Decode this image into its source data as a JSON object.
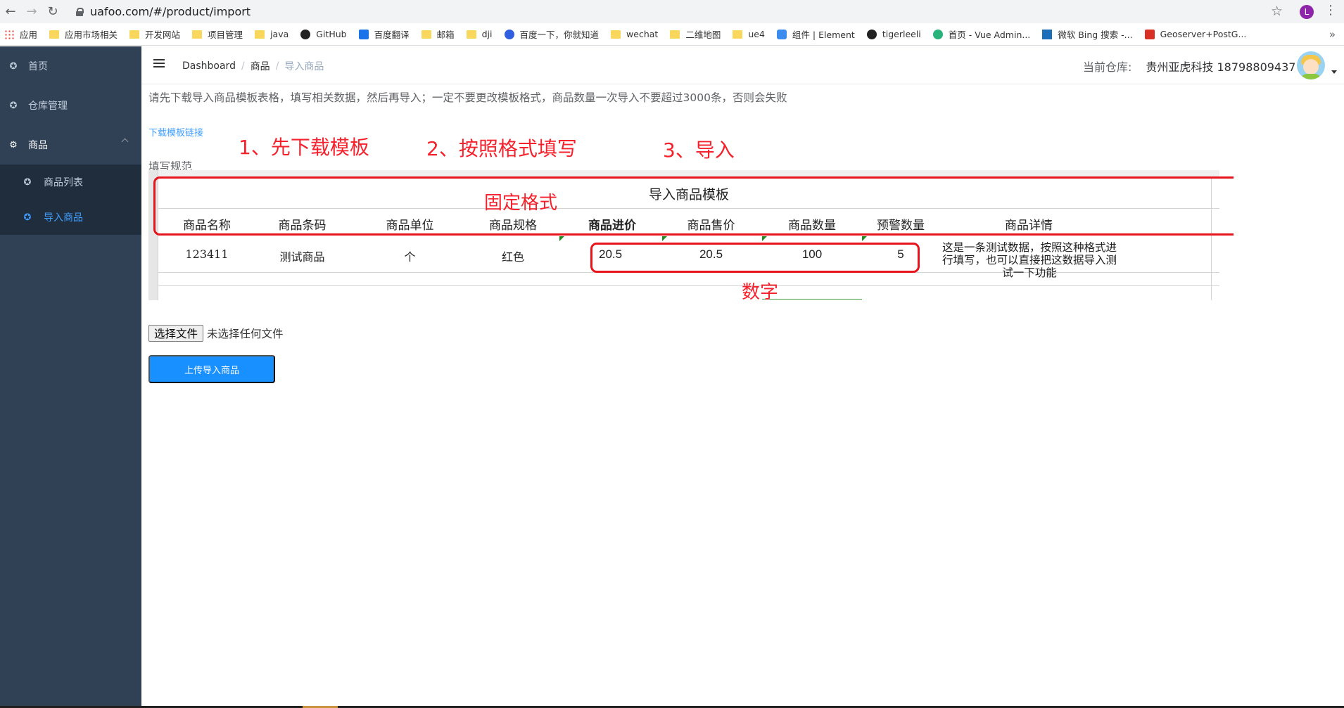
{
  "browser": {
    "url": "uafoo.com/#/product/import",
    "profile_initial": "L",
    "bookmarks": [
      "应用",
      "应用市场相关",
      "开发网站",
      "项目管理",
      "java",
      "GitHub",
      "百度翻译",
      "邮箱",
      "dji",
      "百度一下，你就知道",
      "wechat",
      "二维地图",
      "ue4",
      "组件 | Element",
      "tigerleeli",
      "首页 - Vue Admin...",
      "微软 Bing 搜索 -...",
      "Geoserver+PostG..."
    ],
    "bookmark_icons": [
      "apps-icon",
      "folder-icon",
      "folder-icon",
      "folder-icon",
      "folder-icon",
      "github-icon",
      "translate-icon",
      "folder-icon",
      "folder-icon",
      "baidu-icon",
      "folder-icon",
      "folder-icon",
      "folder-icon",
      "element-icon",
      "github-icon",
      "vue-icon",
      "bing-icon",
      "geoserver-icon"
    ],
    "more": "»"
  },
  "sidebar": {
    "home": "首页",
    "warehouse": "仓库管理",
    "product": "商品",
    "product_list": "商品列表",
    "import_product": "导入商品"
  },
  "navbar": {
    "breadcrumb": [
      "Dashboard",
      "商品",
      "导入商品"
    ],
    "warehouse_label": "当前仓库:",
    "warehouse_value": "贵州亚虎科技 18798809437"
  },
  "content": {
    "notice": "请先下载导入商品模板表格，填写相关数据，然后再导入；一定不要更改模板格式，商品数量一次导入不要超过3000条，否则会失败",
    "download_link": "下载模板链接",
    "rule_label": "填写规范",
    "file_button": "选择文件",
    "file_none": "未选择任何文件",
    "upload_button": "上传导入商品"
  },
  "annotations": {
    "step1": "1、先下载模板",
    "step2": "2、按照格式填写",
    "step3": "3、导入",
    "fixed": "固定格式",
    "number": "数字",
    "color": "#f5222d"
  },
  "template": {
    "title": "导入商品模板",
    "headers": [
      "商品名称",
      "商品条码",
      "商品单位",
      "商品规格",
      "商品进价",
      "商品售价",
      "商品数量",
      "预警数量",
      "商品详情"
    ],
    "row": [
      "123411",
      "测试商品",
      "个",
      "红色",
      "20.5",
      "20.5",
      "100",
      "5",
      "这是一条测试数据，按照这种格式进行填写，也可以直接把这数据导入测试一下功能"
    ]
  },
  "colors": {
    "sidebar_bg": "#304156",
    "submenu_bg": "#1f2d3d",
    "accent": "#409eff",
    "upload_btn": "#1890ff"
  }
}
